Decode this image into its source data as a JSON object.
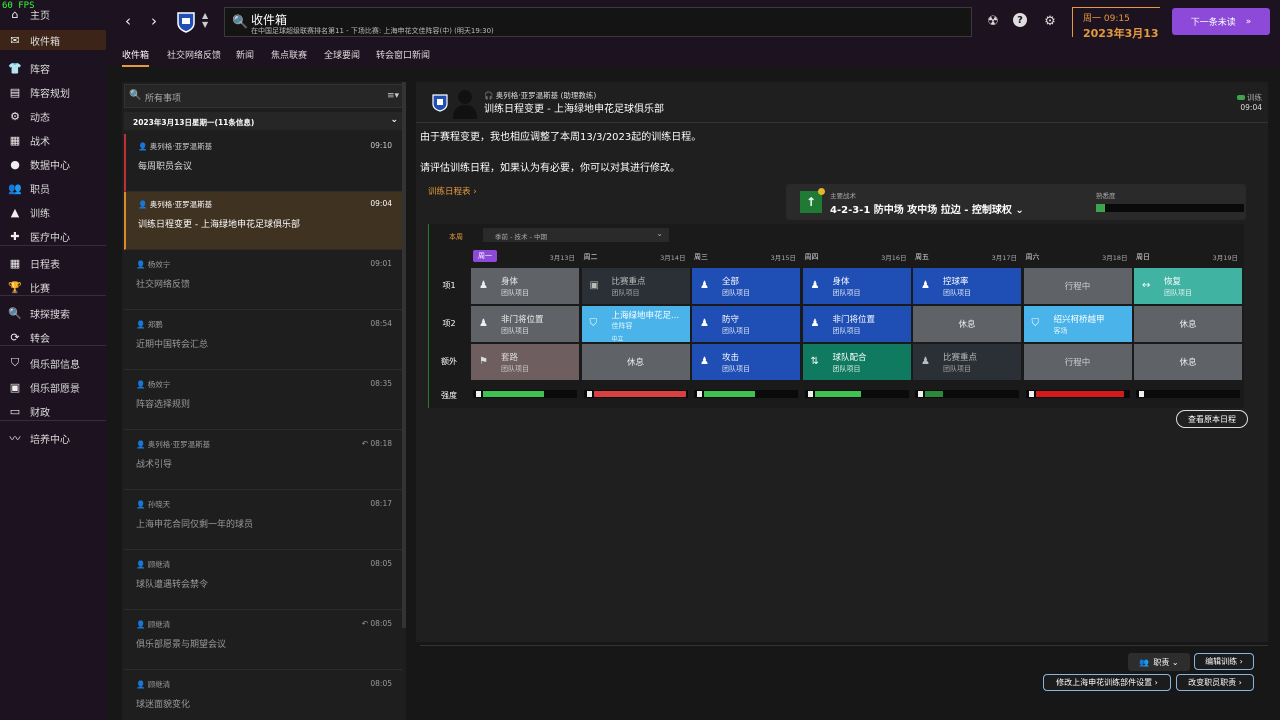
{
  "fps": "60 FPS",
  "nav": {
    "badge": "1",
    "items": [
      {
        "label": "主页",
        "icon": "home-icon",
        "glyph": "⌂"
      },
      {
        "label": "收件箱",
        "icon": "inbox-icon",
        "glyph": "✉"
      },
      {
        "label": "阵容",
        "icon": "shirt-icon",
        "glyph": "👕"
      },
      {
        "label": "阵容规划",
        "icon": "clipboard-icon",
        "glyph": "▤"
      },
      {
        "label": "动态",
        "icon": "dynamics-icon",
        "glyph": "⚙"
      },
      {
        "label": "战术",
        "icon": "tactics-icon",
        "glyph": "▦"
      },
      {
        "label": "数据中心",
        "icon": "data-icon",
        "glyph": "●"
      },
      {
        "label": "职员",
        "icon": "staff-icon",
        "glyph": "👥"
      },
      {
        "label": "训练",
        "icon": "training-icon",
        "glyph": "▲"
      },
      {
        "label": "医疗中心",
        "icon": "medical-icon",
        "glyph": "✚"
      },
      {
        "label": "日程表",
        "icon": "calendar-icon",
        "glyph": "▦"
      },
      {
        "label": "比赛",
        "icon": "trophy-icon",
        "glyph": "🏆"
      },
      {
        "label": "球探搜索",
        "icon": "scouting-icon",
        "glyph": "🔍"
      },
      {
        "label": "转会",
        "icon": "transfer-icon",
        "glyph": "⟳"
      },
      {
        "label": "俱乐部信息",
        "icon": "club-info-icon",
        "glyph": "⛉"
      },
      {
        "label": "俱乐部愿景",
        "icon": "vision-icon",
        "glyph": "▣"
      },
      {
        "label": "财政",
        "icon": "finance-icon",
        "glyph": "▭"
      },
      {
        "label": "培养中心",
        "icon": "development-icon",
        "glyph": "〰"
      }
    ]
  },
  "top": {
    "title": "收件箱",
    "subtitle": "在中国足球超级联赛排名第11 - 下场比赛: 上海申花文佳阵容(中) (明天19:30)",
    "day_time": "周一 09:15",
    "date": "2023年3月13日",
    "next_label": "下一条未读"
  },
  "tabs": [
    "收件箱",
    "社交网络反馈",
    "新闻",
    "焦点联赛",
    "全球要闻",
    "转会窗口新闻"
  ],
  "list": {
    "search_placeholder": "所有事项",
    "filter": "≡▾",
    "date_header": "2023年3月13日星期一(11条信息)",
    "messages": [
      {
        "from": "奥列格·亚罗温斯基",
        "time": "09:10",
        "subject": "每周职员会议",
        "state": "redmark"
      },
      {
        "from": "奥列格·亚罗温斯基",
        "time": "09:04",
        "subject": "训练日程变更 - 上海绿地申花足球俱乐部",
        "state": "selected"
      },
      {
        "from": "杨效宁",
        "time": "09:01",
        "subject": "社交网络反馈",
        "state": "read"
      },
      {
        "from": "郑鹏",
        "time": "08:54",
        "subject": "近期中国转会汇总",
        "state": "read"
      },
      {
        "from": "杨效宁",
        "time": "08:35",
        "subject": "阵容选择规则",
        "state": "read"
      },
      {
        "from": "奥列格·亚罗温斯基",
        "time": "08:18",
        "subject": "战术引导",
        "state": "read"
      },
      {
        "from": "孙晓天",
        "time": "08:17",
        "subject": "上海申花合同仅剩一年的球员",
        "state": "read"
      },
      {
        "from": "顾继清",
        "time": "08:05",
        "subject": "球队遭遇转会禁令",
        "state": "read"
      },
      {
        "from": "顾继清",
        "time": "08:05",
        "subject": "俱乐部愿景与期望会议",
        "state": "read"
      },
      {
        "from": "顾继清",
        "time": "08:05",
        "subject": "球迷面貌变化",
        "state": "read"
      }
    ]
  },
  "detail": {
    "from": "奥列格·亚罗温斯基 (助理教练)",
    "subject": "训练日程变更 - 上海绿地申花足球俱乐部",
    "tag": "训练",
    "time": "09:04",
    "para1": "由于赛程变更，我也相应调整了本周13/3/2023起的训练日程。",
    "para2": "请评估训练日程，如果认为有必要，你可以对其进行修改。",
    "schedule_link": "训练日程表 ›",
    "tactic_label": "主要战术",
    "tactic_name": "4-2-3-1 防中场 攻中场 拉边 - 控制球权 ⌄",
    "familiarity_label": "熟悉度",
    "familiarity": 0.06,
    "week_label": "本周",
    "phase": "季前 - 技术 - 中期",
    "days": [
      {
        "name": "周一",
        "date": "3月13日"
      },
      {
        "name": "周二",
        "date": "3月14日"
      },
      {
        "name": "周三",
        "date": "3月15日"
      },
      {
        "name": "周四",
        "date": "3月16日"
      },
      {
        "name": "周五",
        "date": "3月17日"
      },
      {
        "name": "周六",
        "date": "3月18日"
      },
      {
        "name": "周日",
        "date": "3月19日"
      }
    ],
    "rows": [
      "项1",
      "项2",
      "额外",
      "强度"
    ],
    "sessions": [
      [
        {
          "l1": "身体",
          "l2": "团队项目",
          "c": "c-grey",
          "i": "♟"
        },
        {
          "l1": "比赛重点",
          "l2": "团队项目",
          "c": "c-dark",
          "i": "▣"
        },
        {
          "l1": "全部",
          "l2": "团队项目",
          "c": "c-blue",
          "i": "♟"
        },
        {
          "l1": "身体",
          "l2": "团队项目",
          "c": "c-blue",
          "i": "♟"
        },
        {
          "l1": "控球率",
          "l2": "团队项目",
          "c": "c-blue",
          "i": "♟"
        },
        {
          "center": "行程中",
          "c": "c-busy"
        },
        {
          "l1": "恢复",
          "l2": "团队项目",
          "c": "c-mint",
          "i": "↔"
        }
      ],
      [
        {
          "l1": "非门将位置",
          "l2": "团队项目",
          "c": "c-grey",
          "i": "♟"
        },
        {
          "l1": "上海绿地申花足...",
          "l2": "佳阵容",
          "l3": "中立",
          "c": "c-cyan",
          "i": "⛉"
        },
        {
          "l1": "防守",
          "l2": "团队项目",
          "c": "c-blue",
          "i": "♟"
        },
        {
          "l1": "非门将位置",
          "l2": "团队项目",
          "c": "c-blue",
          "i": "♟"
        },
        {
          "center": "休息",
          "c": "c-grey"
        },
        {
          "l1": "绍兴柯桥越甲",
          "l2": "客场",
          "c": "c-cyan",
          "i": "⛉"
        },
        {
          "center": "休息",
          "c": "c-grey"
        }
      ],
      [
        {
          "l1": "套路",
          "l2": "团队项目",
          "c": "c-rose",
          "i": "⚑"
        },
        {
          "center": "休息",
          "c": "c-grey"
        },
        {
          "l1": "攻击",
          "l2": "团队项目",
          "c": "c-blue",
          "i": "♟"
        },
        {
          "l1": "球队配合",
          "l2": "团队项目",
          "c": "c-teal",
          "i": "⇅"
        },
        {
          "l1": "比赛重点",
          "l2": "团队项目",
          "c": "c-dark",
          "i": "♟"
        },
        {
          "center": "行程中",
          "c": "c-busy"
        },
        {
          "center": "休息",
          "c": "c-grey"
        }
      ]
    ],
    "intensity": [
      {
        "v": 0.66,
        "color": "#3fc24f"
      },
      {
        "v": 1.0,
        "color": "#d94141"
      },
      {
        "v": 0.55,
        "color": "#3fc24f"
      },
      {
        "v": 0.5,
        "color": "#3fc24f"
      },
      {
        "v": 0.2,
        "color": "#2a8a3a"
      },
      {
        "v": 0.96,
        "color": "#d41a1a"
      },
      {
        "v": 0.0,
        "color": "#3fc24f"
      }
    ],
    "view_original": "查看原本日程",
    "roles_btn": "职责 ⌄",
    "edit_training": "编辑训练 ›",
    "modify_unit": "修改上海申花训练部件设置 ›",
    "change_roles": "改变职员职责 ›"
  }
}
